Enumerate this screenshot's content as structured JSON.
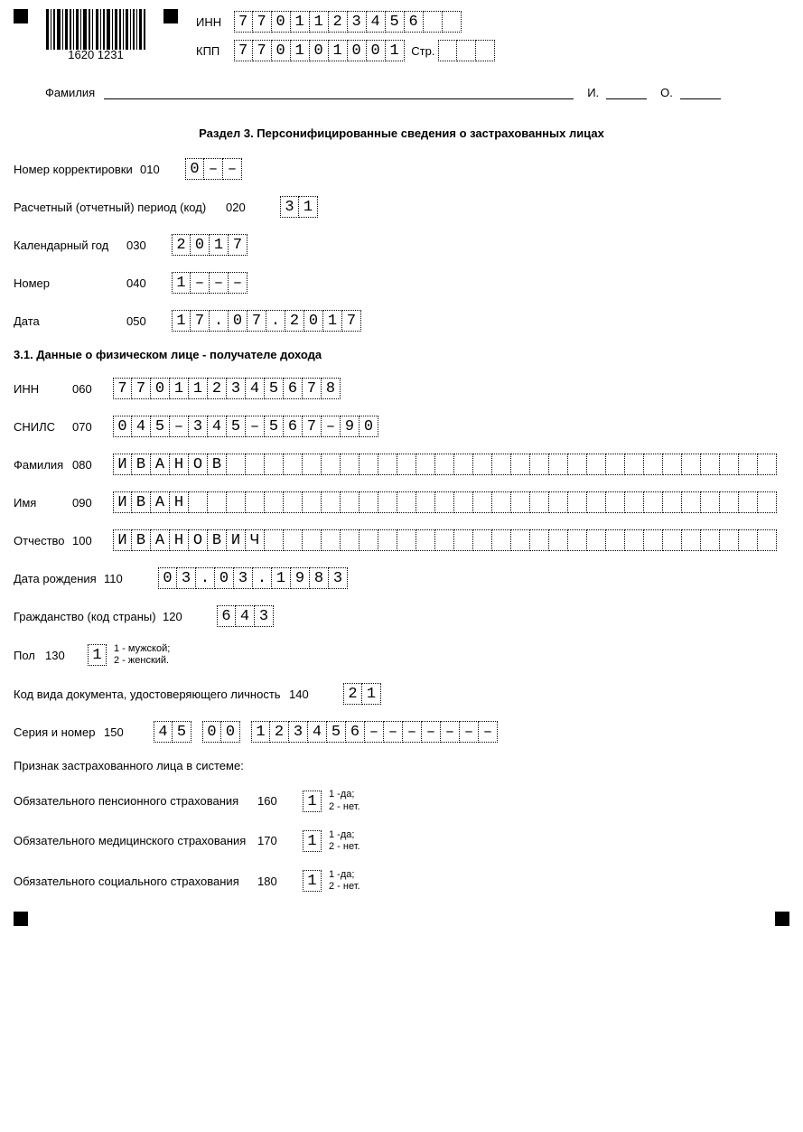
{
  "barcode_text": "1620 1231",
  "header": {
    "inn_label": "ИНН",
    "inn": [
      "7",
      "7",
      "0",
      "1",
      "1",
      "2",
      "3",
      "4",
      "5",
      "6",
      "",
      ""
    ],
    "kpp_label": "КПП",
    "kpp": [
      "7",
      "7",
      "0",
      "1",
      "0",
      "1",
      "0",
      "0",
      "1"
    ],
    "page_label": "Стр.",
    "page": [
      "",
      "",
      ""
    ]
  },
  "family_label": "Фамилия",
  "initial_i": "И.",
  "initial_o": "О.",
  "section_title": "Раздел 3. Персонифицированные сведения о застрахованных лицах",
  "rows": {
    "r010": {
      "label": "Номер корректировки",
      "code": "010",
      "cells": [
        "0",
        "–",
        "–"
      ]
    },
    "r020": {
      "label": "Расчетный (отчетный) период (код)",
      "code": "020",
      "cells": [
        "3",
        "1"
      ]
    },
    "r030": {
      "label": "Календарный год",
      "code": "030",
      "cells": [
        "2",
        "0",
        "1",
        "7"
      ]
    },
    "r040": {
      "label": "Номер",
      "code": "040",
      "cells": [
        "1",
        "–",
        "–",
        "–"
      ]
    },
    "r050": {
      "label": "Дата",
      "code": "050",
      "cells": [
        "1",
        "7",
        ".",
        "0",
        "7",
        ".",
        "2",
        "0",
        "1",
        "7"
      ]
    }
  },
  "sub31": "3.1. Данные о физическом лице - получателе дохода",
  "rows2": {
    "r060": {
      "label": "ИНН",
      "code": "060",
      "cells": [
        "7",
        "7",
        "0",
        "1",
        "1",
        "2",
        "3",
        "4",
        "5",
        "6",
        "7",
        "8"
      ]
    },
    "r070": {
      "label": "СНИЛС",
      "code": "070",
      "cells": [
        "0",
        "4",
        "5",
        "–",
        "3",
        "4",
        "5",
        "–",
        "5",
        "6",
        "7",
        "–",
        "9",
        "0"
      ]
    },
    "r080": {
      "label": "Фамилия",
      "code": "080",
      "cells": [
        "И",
        "В",
        "А",
        "Н",
        "О",
        "В",
        "",
        "",
        "",
        "",
        "",
        "",
        "",
        "",
        "",
        "",
        "",
        "",
        "",
        "",
        "",
        "",
        "",
        "",
        "",
        "",
        "",
        "",
        "",
        "",
        "",
        "",
        "",
        "",
        ""
      ]
    },
    "r090": {
      "label": "Имя",
      "code": "090",
      "cells": [
        "И",
        "В",
        "А",
        "Н",
        "",
        "",
        "",
        "",
        "",
        "",
        "",
        "",
        "",
        "",
        "",
        "",
        "",
        "",
        "",
        "",
        "",
        "",
        "",
        "",
        "",
        "",
        "",
        "",
        "",
        "",
        "",
        "",
        "",
        "",
        ""
      ]
    },
    "r100": {
      "label": "Отчество",
      "code": "100",
      "cells": [
        "И",
        "В",
        "А",
        "Н",
        "О",
        "В",
        "И",
        "Ч",
        "",
        "",
        "",
        "",
        "",
        "",
        "",
        "",
        "",
        "",
        "",
        "",
        "",
        "",
        "",
        "",
        "",
        "",
        "",
        "",
        "",
        "",
        "",
        "",
        "",
        "",
        ""
      ]
    },
    "r110": {
      "label": "Дата рождения",
      "code": "110",
      "cells": [
        "0",
        "3",
        ".",
        "0",
        "3",
        ".",
        "1",
        "9",
        "8",
        "3"
      ]
    },
    "r120": {
      "label": "Гражданство (код страны)",
      "code": "120",
      "cells": [
        "6",
        "4",
        "3"
      ]
    },
    "r130": {
      "label": "Пол",
      "code": "130",
      "cells": [
        "1"
      ],
      "hint": "1 - мужской;\n2 - женский."
    },
    "r140": {
      "label": "Код вида документа, удостоверяющего личность",
      "code": "140",
      "cells": [
        "2",
        "1"
      ]
    },
    "r150": {
      "label": "Серия и номер",
      "code": "150",
      "groups": [
        [
          "4",
          "5"
        ],
        [
          "0",
          "0"
        ],
        [
          "1",
          "2",
          "3",
          "4",
          "5",
          "6",
          "–",
          "–",
          "–",
          "–",
          "–",
          "–",
          "–"
        ]
      ]
    }
  },
  "insured_title": "Признак застрахованного лица в системе:",
  "insured": {
    "r160": {
      "label": "Обязательного пенсионного страхования",
      "code": "160",
      "cells": [
        "1"
      ],
      "hint": "1 -да;\n2 - нет."
    },
    "r170": {
      "label": "Обязательного медицинского страхования",
      "code": "170",
      "cells": [
        "1"
      ],
      "hint": "1 -да;\n2 - нет."
    },
    "r180": {
      "label": "Обязательного социального страхования",
      "code": "180",
      "cells": [
        "1"
      ],
      "hint": "1 -да;\n2 - нет."
    }
  }
}
